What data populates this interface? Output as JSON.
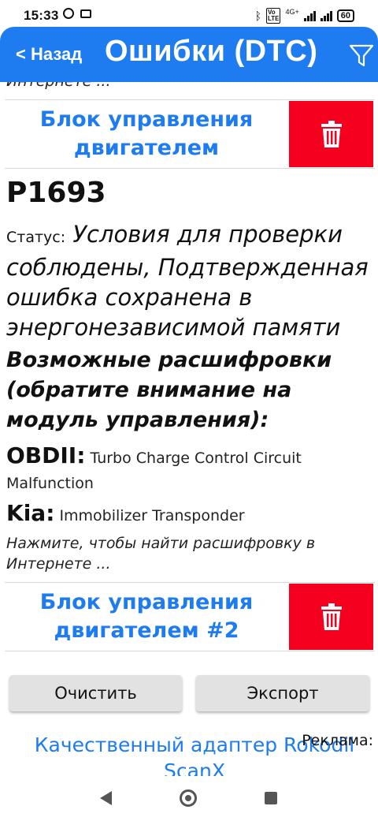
{
  "status_bar": {
    "time": "15:33",
    "network": "4G+",
    "battery": "60"
  },
  "app_bar": {
    "back_label": "< Назад",
    "title": "Ошибки (DTC)",
    "filter_icon": "filter-icon",
    "color": "#1e7cf0"
  },
  "list": {
    "cut_text": "Интернете ...",
    "ecu_rows": [
      {
        "label": "Блок управления двигателем",
        "delete_icon": "trash-icon"
      },
      {
        "label": "Блок управления двигателем #2",
        "delete_icon": "trash-icon"
      }
    ],
    "dtc": {
      "code": "P1693",
      "status_label": "Статус:",
      "status_value": "Условия для проверки соблюдены, Подтвержденная ошибка сохранена в энергонезависимой памяти",
      "possible_header": "Возможные расшифровки (обратите внимание на модуль управления):",
      "decodes": [
        {
          "brand": "OBDII:",
          "text": "Turbo Charge Control Circuit Malfunction"
        },
        {
          "brand": "Kia:",
          "text": "Immobilizer Transponder"
        }
      ],
      "search_hint": "Нажмите, чтобы найти расшифровку в Интернете ..."
    },
    "delete_color": "#f5001e"
  },
  "actions": {
    "clear_label": "Очистить",
    "export_label": "Экспорт"
  },
  "ad": {
    "label": "Реклама:",
    "link_text": "Качественный адаптер Rokodil ScanX"
  }
}
